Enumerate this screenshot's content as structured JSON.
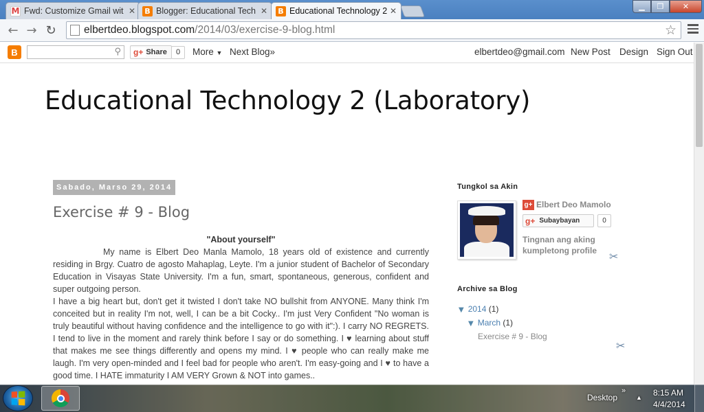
{
  "browser": {
    "tabs": [
      {
        "label": "Fwd: Customize Gmail wit",
        "icon": "gmail-icon",
        "active": false
      },
      {
        "label": "Blogger: Educational Tech",
        "icon": "blogger-icon",
        "active": false
      },
      {
        "label": "Educational Technology 2",
        "icon": "blogger-icon",
        "active": true
      }
    ],
    "url_host": "elbertdeo.blogspot.com",
    "url_path": "/2014/03/exercise-9-blog.html"
  },
  "navbar": {
    "share_label": "Share",
    "share_count": "0",
    "more_label": "More",
    "next_blog_label": "Next Blog»",
    "email": "elbertdeo@gmail.com",
    "new_post_label": "New Post",
    "design_label": "Design",
    "sign_out_label": "Sign Out"
  },
  "blog": {
    "title": "Educational Technology 2 (Laboratory)",
    "date_header": "Sabado, Marso 29, 2014",
    "post_title": "Exercise # 9 - Blog",
    "about_heading": "\"About yourself\"",
    "paragraph1": "My name is Elbert Deo Manla Mamolo, 18 years old of existence and currently residing in Brgy. Cuatro de agosto Mahaplag, Leyte. I'm a junior student of  Bachelor of Secondary Education in Visayas State University. I'm a fun, smart, spontaneous, generous, confident and super outgoing person.",
    "paragraph2": "I have a big heart but, don't get it twisted I don't take NO bullshit from ANYONE. Many think I'm conceited but in reality I'm not, well, I can be a bit Cocky.. I'm just Very Confident \"No woman is truly beautiful without having confidence and the intelligence to go with it\":). I carry NO REGRETS. I tend to live in the moment and rarely think before I say or do something. I ♥ learning about stuff that makes me see things differently and opens my mind. I ♥ people who can really make me laugh. I'm very open-minded and I feel bad for people who aren't. I'm easy-going and I ♥ to have a good time. I HATE immaturity I AM VERY Grown & NOT into games.."
  },
  "sidebar": {
    "about_heading": "Tungkol sa Akin",
    "profile_name": "Elbert Deo Mamolo",
    "follow_label": "Subaybayan",
    "follow_count": "0",
    "profile_link": "Tingnan ang aking kumpletong profile",
    "archive_heading": "Archive sa Blog",
    "archive": {
      "year": "2014",
      "year_count": "(1)",
      "month": "March",
      "month_count": "(1)",
      "post": "Exercise # 9 - Blog"
    }
  },
  "taskbar": {
    "desktop_label": "Desktop",
    "time": "8:15 AM",
    "date": "4/4/2014"
  }
}
